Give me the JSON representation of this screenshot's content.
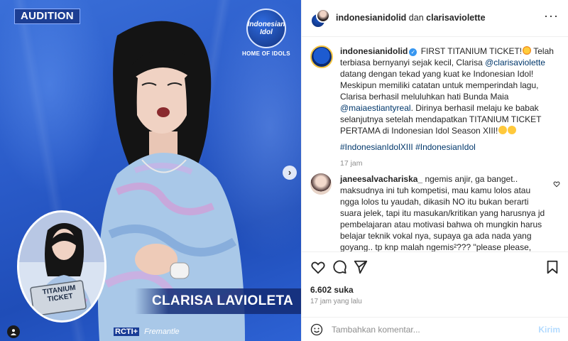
{
  "media": {
    "badge": "AUDITION",
    "logo_lines": [
      "Indonesian",
      "Idol"
    ],
    "logo_sub": "HOME OF IDOLS",
    "name_banner": "CLARISA LAVIOLETA",
    "inset_ticket": "TITANIUM TICKET",
    "footer_rcti": "RCTI+",
    "footer_fremantle": "Fremantle",
    "next_icon": "chevron-right-icon",
    "tag_icon": "user-tag-icon",
    "colors": {
      "bg": "#2a5bc9",
      "banner": "#142d78"
    }
  },
  "header": {
    "account": "indonesianidolid",
    "joiner": "dan",
    "collaborator": "clarisaviolette",
    "more_icon": "more-icon"
  },
  "caption": {
    "username": "indonesianidolid",
    "text_1": "FIRST TITANIUM TICKET!",
    "text_2": " Telah terbiasa bernyanyi sejak kecil, Clarisa ",
    "mention_1": "@clarisaviolette",
    "text_3": " datang dengan tekad yang kuat ke Indonesian Idol! Meskipun memiliki catatan untuk memperindah lagu, Clarisa berhasil meluluhkan hati Bunda Maia ",
    "mention_2": "@maiaestiantyreal",
    "text_4": ". Dirinya berhasil melaju ke babak selanjutnya setelah mendapatkan TITANIUM TICKET PERTAMA di Indonesian Idol Season XIII!",
    "hashtags": "#IndonesianIdolXIII #IndonesianIdol",
    "time": "17 jam"
  },
  "comment": {
    "username": "janeesalvachariska_",
    "text": "ngemis anjir, ga banget.. maksudnya ini tuh kompetisi, mau kamu lolos atau ngga lolos tu yaudah, dikasih NO itu bukan berarti suara jelek, tapi itu masukan/kritikan yang harusnya jd pembelajaran atau motivasi bahwa oh mungkin harus belajar teknik vokal nya, supaya ga ada nada yang goyang.. tp knp malah ngemis²??? \"please please, kasih aku kesempatan\" hadehh.. gatau yg lain gmn di"
  },
  "actions": {
    "like_icon": "heart-icon",
    "comment_icon": "comment-icon",
    "share_icon": "send-icon",
    "save_icon": "bookmark-icon"
  },
  "stats": {
    "likes": "6.602 suka",
    "posted": "17 jam yang lalu"
  },
  "composer": {
    "placeholder": "Tambahkan komentar...",
    "post_label": "Kirim",
    "emoji_icon": "emoji-icon"
  }
}
